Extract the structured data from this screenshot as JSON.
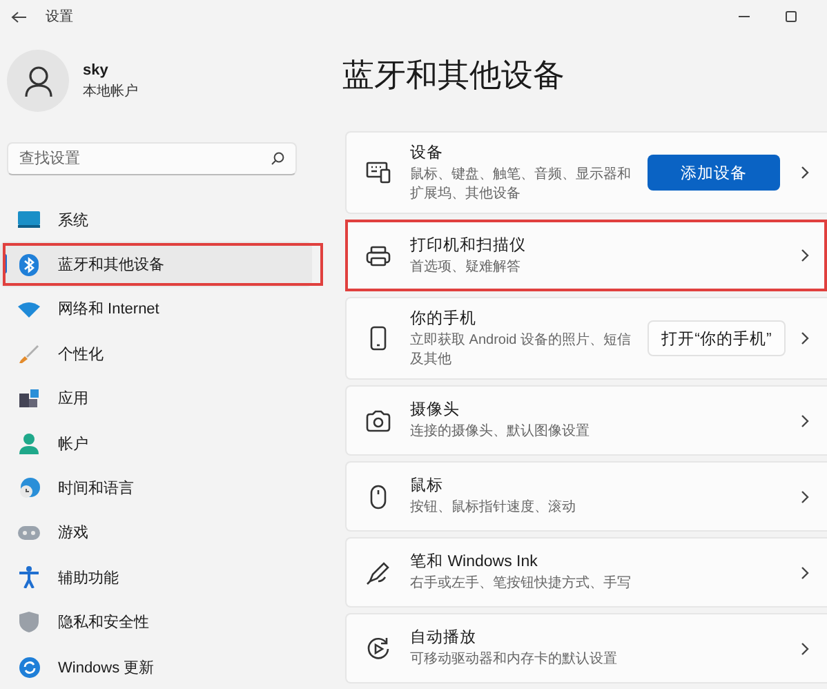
{
  "window": {
    "title": "设置"
  },
  "profile": {
    "name": "sky",
    "account": "本地帐户"
  },
  "search": {
    "placeholder": "查找设置"
  },
  "nav": [
    {
      "label": "系统",
      "selected": false,
      "highlighted": false
    },
    {
      "label": "蓝牙和其他设备",
      "selected": true,
      "highlighted": true
    },
    {
      "label": "网络和 Internet",
      "selected": false,
      "highlighted": false
    },
    {
      "label": "个性化",
      "selected": false,
      "highlighted": false
    },
    {
      "label": "应用",
      "selected": false,
      "highlighted": false
    },
    {
      "label": "帐户",
      "selected": false,
      "highlighted": false
    },
    {
      "label": "时间和语言",
      "selected": false,
      "highlighted": false
    },
    {
      "label": "游戏",
      "selected": false,
      "highlighted": false
    },
    {
      "label": "辅助功能",
      "selected": false,
      "highlighted": false
    },
    {
      "label": "隐私和安全性",
      "selected": false,
      "highlighted": false
    },
    {
      "label": "Windows 更新",
      "selected": false,
      "highlighted": false
    }
  ],
  "page_title": "蓝牙和其他设备",
  "cards": [
    {
      "title": "设备",
      "subtitle": "鼠标、键盘、触笔、音频、显示器和扩展坞、其他设备",
      "highlighted": false,
      "action": {
        "label": "添加设备",
        "kind": "primary"
      }
    },
    {
      "title": "打印机和扫描仪",
      "subtitle": "首选项、疑难解答",
      "highlighted": true
    },
    {
      "title": "你的手机",
      "subtitle": "立即获取 Android 设备的照片、短信及其他",
      "highlighted": false,
      "action": {
        "label": "打开“你的手机”",
        "kind": "secondary"
      }
    },
    {
      "title": "摄像头",
      "subtitle": "连接的摄像头、默认图像设置",
      "highlighted": false
    },
    {
      "title": "鼠标",
      "subtitle": "按钮、鼠标指针速度、滚动",
      "highlighted": false
    },
    {
      "title": "笔和 Windows Ink",
      "subtitle": "右手或左手、笔按钮快捷方式、手写",
      "highlighted": false
    },
    {
      "title": "自动播放",
      "subtitle": "可移动驱动器和内存卡的默认设置",
      "highlighted": false
    }
  ]
}
